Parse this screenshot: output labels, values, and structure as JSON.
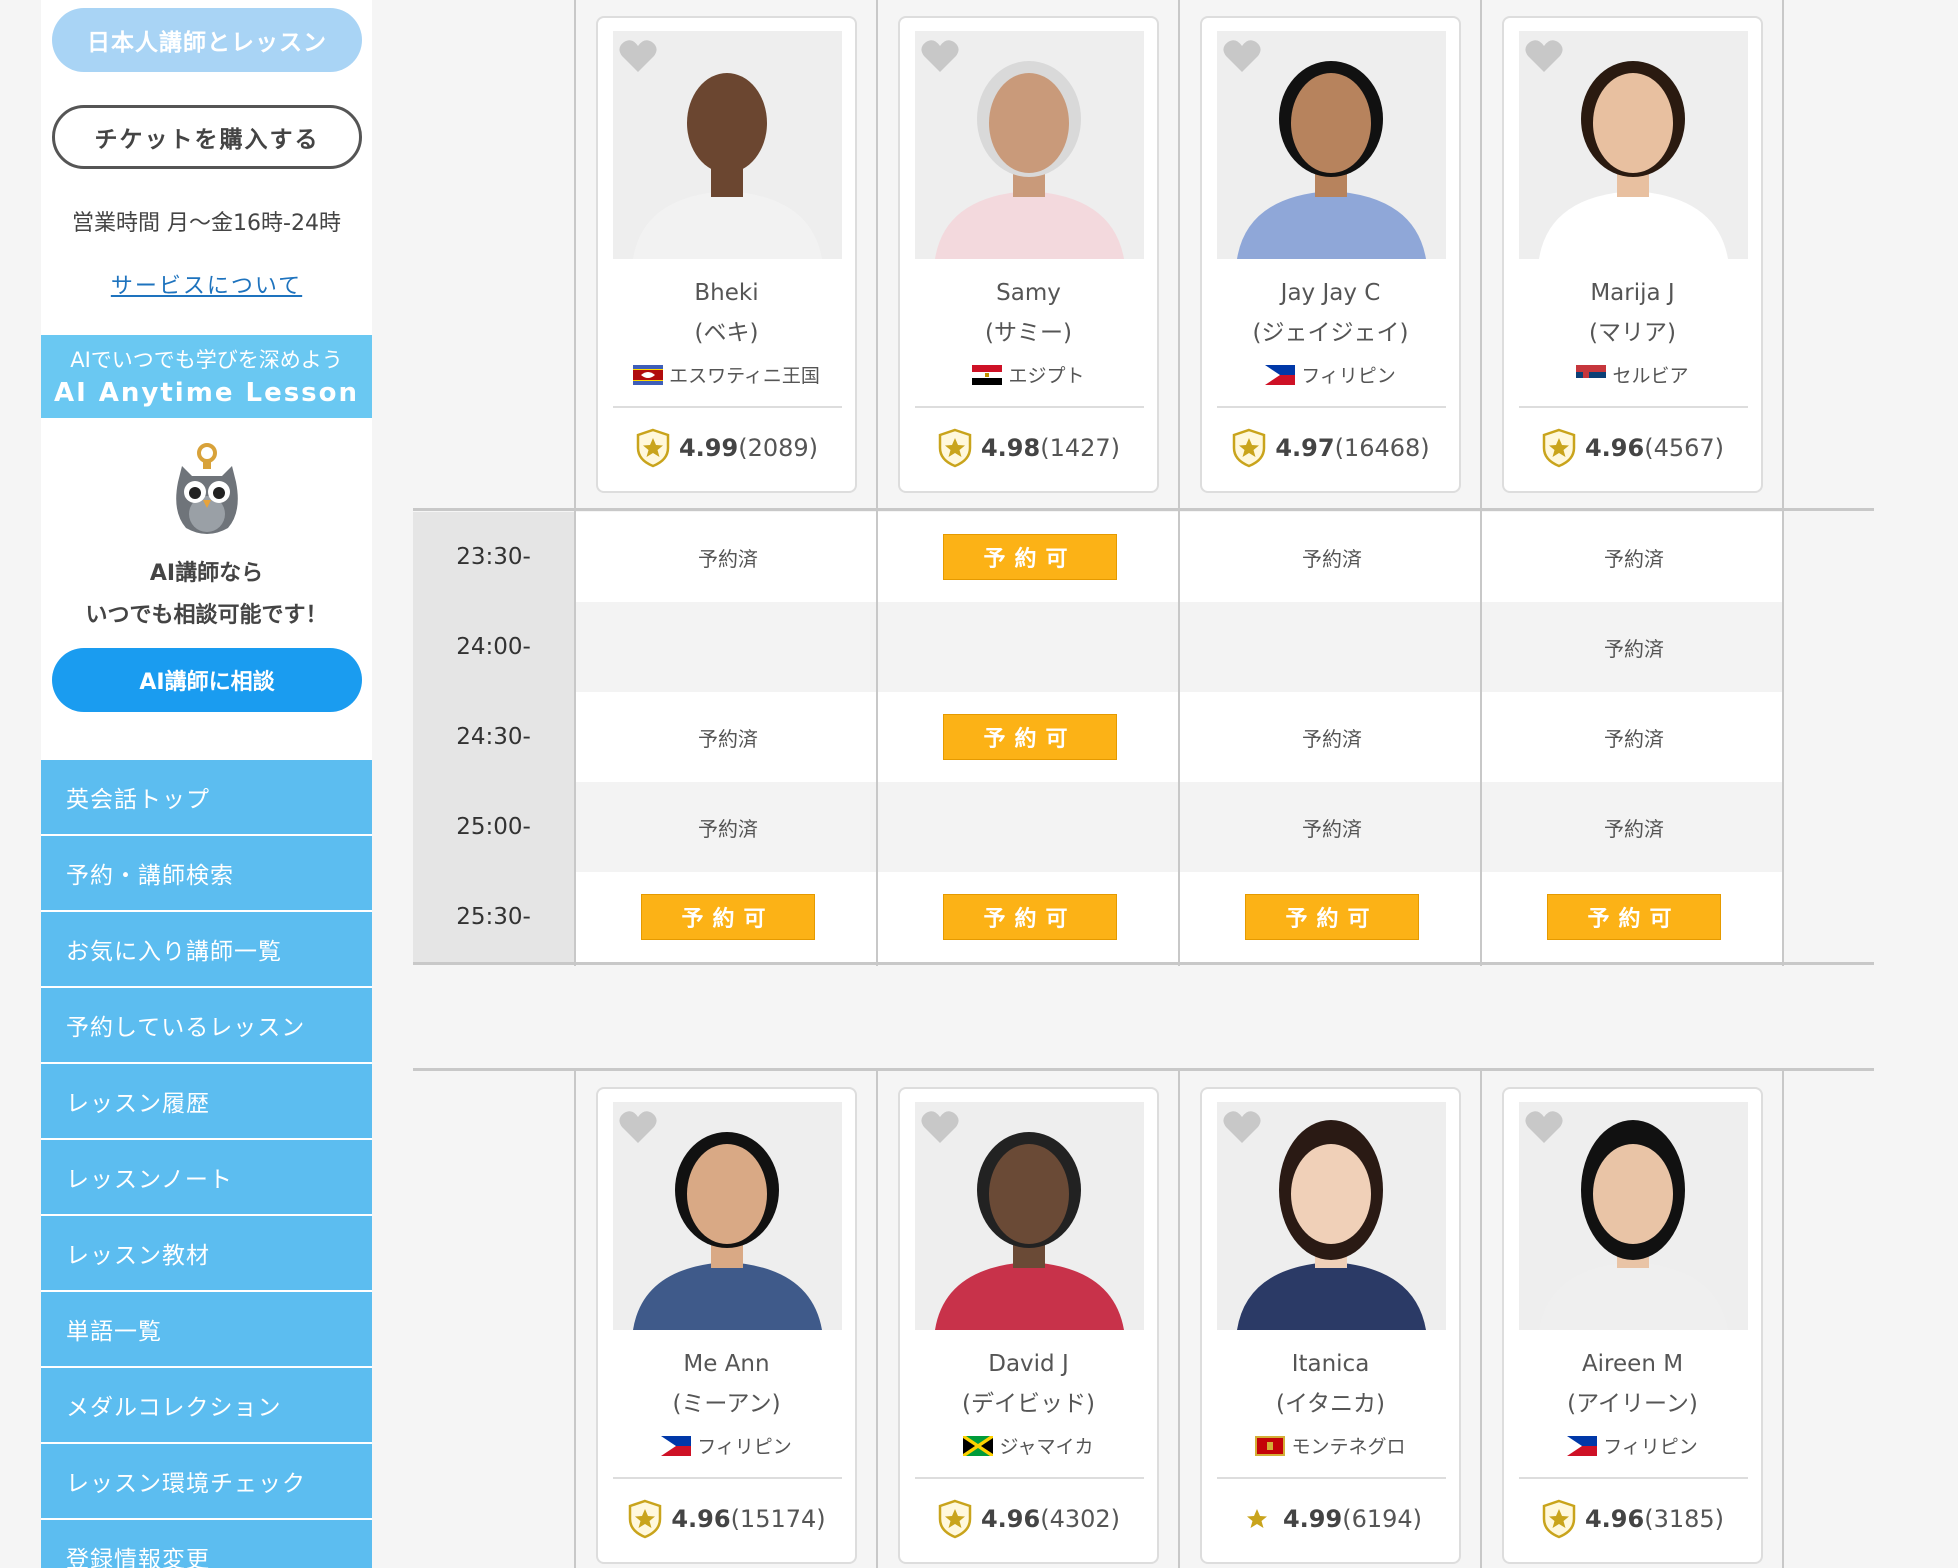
{
  "sidebar": {
    "jp_lesson_button": "日本人講師とレッスン",
    "ticket_button": "チケットを購入する",
    "hours": "営業時間 月〜金16時-24時",
    "service_link": "サービスについて",
    "ai_banner_line1": "AIでいつでも学びを深めよう",
    "ai_banner_line2": "AI Anytime Lesson",
    "ai_text_line1": "AI講師なら",
    "ai_text_line2": "いつでも相談可能です！",
    "ai_button": "AI講師に相談",
    "menu": [
      "英会話トップ",
      "予約・講師検索",
      "お気に入り講師一覧",
      "予約しているレッスン",
      "レッスン履歴",
      "レッスンノート",
      "レッスン教材",
      "単語一覧",
      "メダルコレクション",
      "レッスン環境チェック",
      "登録情報変更"
    ]
  },
  "teachers_top": [
    {
      "name": "Bheki",
      "kana": "(ベキ)",
      "country": "エスワティニ王国",
      "flag": "eswatini",
      "rating": "4.99",
      "count": "(2089)",
      "badge": "shield-star"
    },
    {
      "name": "Samy",
      "kana": "(サミー)",
      "country": "エジプト",
      "flag": "egypt",
      "rating": "4.98",
      "count": "(1427)",
      "badge": "shield-star"
    },
    {
      "name": "Jay Jay C",
      "kana": "(ジェイジェイ)",
      "country": "フィリピン",
      "flag": "philippines",
      "rating": "4.97",
      "count": "(16468)",
      "badge": "shield-star"
    },
    {
      "name": "Marija J",
      "kana": "(マリア)",
      "country": "セルビア",
      "flag": "serbia",
      "rating": "4.96",
      "count": "(4567)",
      "badge": "shield-star"
    }
  ],
  "teachers_bottom": [
    {
      "name": "Me Ann",
      "kana": "(ミーアン)",
      "country": "フィリピン",
      "flag": "philippines",
      "rating": "4.96",
      "count": "(15174)",
      "badge": "shield-star"
    },
    {
      "name": "David J",
      "kana": "(デイビッド)",
      "country": "ジャマイカ",
      "flag": "jamaica",
      "rating": "4.96",
      "count": "(4302)",
      "badge": "shield-star"
    },
    {
      "name": "Itanica",
      "kana": "(イタニカ)",
      "country": "モンテネグロ",
      "flag": "montenegro",
      "rating": "4.99",
      "count": "(6194)",
      "badge": "star"
    },
    {
      "name": "Aireen M",
      "kana": "(アイリーン)",
      "country": "フィリピン",
      "flag": "philippines",
      "rating": "4.96",
      "count": "(3185)",
      "badge": "shield-star"
    }
  ],
  "labels": {
    "reserved": "予約済",
    "bookable": "予約可"
  },
  "schedule": [
    {
      "time": "23:30-",
      "slots": [
        "reserved",
        "bookable",
        "reserved",
        "reserved"
      ]
    },
    {
      "time": "24:00-",
      "slots": [
        "",
        "",
        "",
        "reserved"
      ]
    },
    {
      "time": "24:30-",
      "slots": [
        "reserved",
        "bookable",
        "reserved",
        "reserved"
      ]
    },
    {
      "time": "25:00-",
      "slots": [
        "reserved",
        "",
        "reserved",
        "reserved"
      ]
    },
    {
      "time": "25:30-",
      "slots": [
        "bookable",
        "bookable",
        "bookable",
        "bookable"
      ]
    }
  ],
  "colors": {
    "accent_orange": "#fcb216",
    "menu_blue": "#5cbdf0",
    "ai_button_blue": "#1a9cf0"
  }
}
